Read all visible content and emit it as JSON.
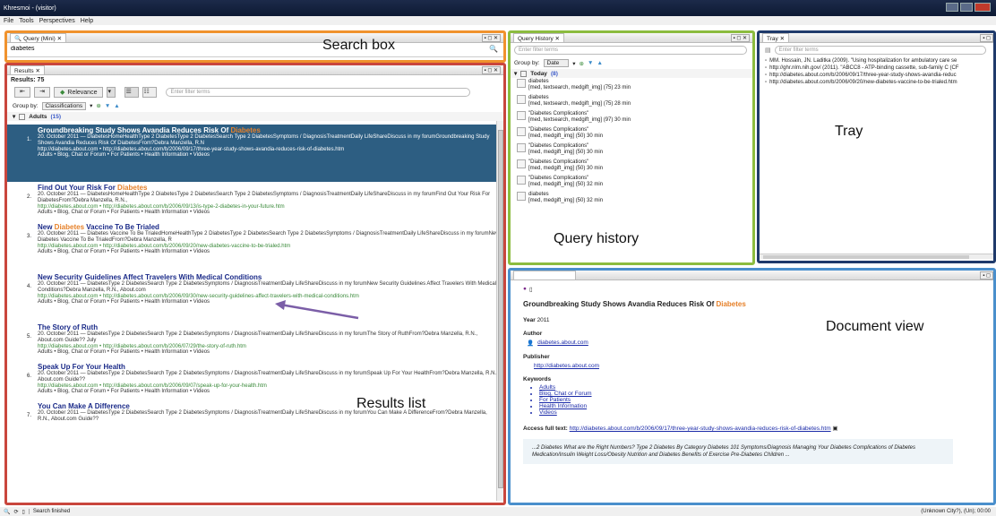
{
  "window": {
    "title": "Khresmoi - (visitor)"
  },
  "menu": [
    "File",
    "Tools",
    "Perspectives",
    "Help"
  ],
  "annotations": {
    "search_box": "Search box",
    "results_list": "Results list",
    "query_history": "Query history",
    "tray": "Tray",
    "document_view": "Document view"
  },
  "query": {
    "tab": "Query (Mini) ✕",
    "value": "diabetes"
  },
  "results": {
    "tab": "Results ✕",
    "count": "Results: 75",
    "sort_label": "Relevance",
    "filter_placeholder": "Enter filter terms",
    "group_by_label": "Group by:",
    "group_by_value": "Classifications",
    "group_name": "Adults",
    "group_count": "(15)",
    "items": [
      {
        "num": "1.",
        "title_pre": "Groundbreaking Study Shows Avandia Reduces Risk Of ",
        "title_hl": "Diabetes",
        "title_post": "",
        "snippet": "20. October 2011 — DiabetesHomeHealthType 2 DiabetesType 2 DiabetesSearch Type 2 DiabetesSymptoms / DiagnosisTreatmentDaily LifeShareDiscuss in my forumGroundbreaking Study Shows Avandia Reduces Risk Of DiabetesFrom?Debra Manzella, R.N",
        "url": "http://diabetes.about.com • http://diabetes.about.com/b/2006/09/17/three-year-study-shows-avandia-reduces-risk-of-diabetes.htm",
        "meta": "Adults • Blog, Chat or Forum • For Patients • Health Information • Videos"
      },
      {
        "num": "2.",
        "title_pre": "Find Out Your Risk For ",
        "title_hl": "Diabetes",
        "title_post": "",
        "snippet": "20. October 2011 — DiabetesHomeHealthType 2 DiabetesType 2 DiabetesSearch Type 2 DiabetesSymptoms / DiagnosisTreatmentDaily LifeShareDiscuss in my forumFind Out Your Risk For DiabetesFrom?Debra Manzella, R.N.,",
        "url": "http://diabetes.about.com • http://diabetes.about.com/b/2006/09/13/is-type-2-diabetes-in-your-future.htm",
        "meta": "Adults • Blog, Chat or Forum • For Patients • Health Information • Videos"
      },
      {
        "num": "3.",
        "title_pre": "New ",
        "title_hl": "Diabetes",
        "title_post": " Vaccine To Be Trialed",
        "snippet": "20. October 2011 — Diabetes Vaccine To Be TrialedHomeHealthType 2 DiabetesType 2 DiabetesSearch Type 2 DiabetesSymptoms / DiagnosisTreatmentDaily LifeShareDiscuss in my forumNew Diabetes Vaccine To Be TrialedFrom?Debra Manzella, R",
        "url": "http://diabetes.about.com • http://diabetes.about.com/b/2006/09/20/new-diabetes-vaccine-to-be-trialed.htm",
        "meta": "Adults • Blog, Chat or Forum • For Patients • Health Information • Videos"
      },
      {
        "num": "4.",
        "title_pre": "New Security Guidelines Affect Travelers With Medical Conditions",
        "title_hl": "",
        "title_post": "",
        "snippet": "20. October 2011 — DiabetesType 2 DiabetesSearch Type 2 DiabetesSymptoms / DiagnosisTreatmentDaily LifeShareDiscuss in my forumNew Security Guidelines Affect Travelers With Medical Conditions?Debra Manzella, R.N., About.com",
        "url": "http://diabetes.about.com • http://diabetes.about.com/b/2006/09/30/new-security-guidelines-affect-travelers-with-medical-conditions.htm",
        "meta": "Adults • Blog, Chat or Forum • For Patients • Health Information • Videos"
      },
      {
        "num": "5.",
        "title_pre": "The Story of Ruth",
        "title_hl": "",
        "title_post": "",
        "snippet": "20. October 2011 — DiabetesType 2 DiabetesSearch Type 2 DiabetesSymptoms / DiagnosisTreatmentDaily LifeShareDiscuss in my forumThe Story of RuthFrom?Debra Manzella, R.N., About.com Guide?? July",
        "url": "http://diabetes.about.com • http://diabetes.about.com/b/2006/07/29/the-story-of-ruth.htm",
        "meta": "Adults • Blog, Chat or Forum • For Patients • Health Information • Videos"
      },
      {
        "num": "6.",
        "title_pre": "Speak Up For Your Health",
        "title_hl": "",
        "title_post": "",
        "snippet": "20. October 2011 — DiabetesType 2 DiabetesSearch Type 2 DiabetesSymptoms / DiagnosisTreatmentDaily LifeShareDiscuss in my forumSpeak Up For Your HealthFrom?Debra Manzella, R.N., About.com Guide??",
        "url": "http://diabetes.about.com • http://diabetes.about.com/b/2006/09/07/speak-up-for-your-health.htm",
        "meta": "Adults • Blog, Chat or Forum • For Patients • Health Information • Videos"
      },
      {
        "num": "7.",
        "title_pre": "You Can Make A Difference",
        "title_hl": "",
        "title_post": "",
        "snippet": "20. October 2011 — DiabetesType 2 DiabetesSearch Type 2 DiabetesSymptoms / DiagnosisTreatmentDaily LifeShareDiscuss in my forumYou Can Make A DifferenceFrom?Debra Manzella, R.N., About.com Guide??",
        "url": "",
        "meta": ""
      }
    ]
  },
  "history": {
    "tab": "Query History ✕",
    "filter_placeholder": "Enter filter terms",
    "group_by_label": "Group by:",
    "group_by_value": "Date",
    "group_name": "Today",
    "group_count": "(8)",
    "items": [
      {
        "q": "diabetes",
        "d": "[med, textsearch, medgift_img] (75) 23 min"
      },
      {
        "q": "diabetes",
        "d": "[med, textsearch, medgift_img] (75) 28 min"
      },
      {
        "q": "\"Diabetes Complications\"",
        "d": "[med, textsearch, medgift_img] (97) 30 min"
      },
      {
        "q": "\"Diabetes Complications\"",
        "d": "[med, medgift_img] (50) 30 min"
      },
      {
        "q": "\"Diabetes Complications\"",
        "d": "[med, medgift_img] (50) 30 min"
      },
      {
        "q": "\"Diabetes Complications\"",
        "d": "[med, medgift_img] (50) 30 min"
      },
      {
        "q": "\"Diabetes Complications\"",
        "d": "[med, medgift_img] (50) 32 min"
      },
      {
        "q": "diabetes",
        "d": "[med, medgift_img] (50) 32 min"
      }
    ]
  },
  "tray": {
    "tab": "Tray ✕",
    "filter_placeholder": "Enter filter terms",
    "items": [
      "MM. Hossain, JN. Laditka (2009). \"Using hospitalization for ambulatory care se",
      "http://ghr.nlm.nih.gov/ (2011). \"ABCC8 - ATP-binding cassette, sub-family C (CF",
      "http://diabetes.about.com/b/2006/09/17/three-year-study-shows-avandia-reduc",
      "http://diabetes.about.com/b/2006/09/20/new-diabetes-vaccine-to-be-trialed.htm"
    ]
  },
  "document": {
    "title_pre": "Groundbreaking Study Shows Avandia Reduces Risk Of ",
    "title_hl": "Diabetes",
    "year_label": "Year",
    "year": "2011",
    "author_label": "Author",
    "author": "diabetes.about.com",
    "publisher_label": "Publisher",
    "publisher": "http://diabetes.about.com",
    "keywords_label": "Keywords",
    "keywords": [
      "Adults",
      "Blog, Chat or Forum",
      "For Patients",
      "Health Information",
      "Videos"
    ],
    "access_label": "Access full text:",
    "access_url": "http://diabetes.about.com/b/2006/09/17/three-year-study-shows-avandia-reduces-risk-of-diabetes.htm",
    "excerpt": "...2 Diabetes What are the Right Numbers? Type 2 Diabetes By Category Diabetes 101 Symptoms/Diagnosis Managing Your Diabetes Complications of Diabetes Medication/Insulin Weight Loss/Obesity Nutrition and Diabetes Benefits of Exercise Pre-Diabetes Children ..."
  },
  "status": {
    "text": "Search finished",
    "right": "(Unknown City?), (Un); 00:00"
  }
}
